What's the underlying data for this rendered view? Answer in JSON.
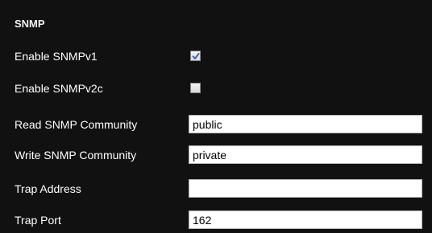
{
  "section": {
    "title": "SNMP"
  },
  "fields": {
    "snmpv1": {
      "label": "Enable SNMPv1",
      "checked": true
    },
    "snmpv2c": {
      "label": "Enable SNMPv2c",
      "checked": false
    },
    "read_community": {
      "label": "Read SNMP Community",
      "value": "public",
      "placeholder": ""
    },
    "write_community": {
      "label": "Write SNMP Community",
      "value": "private",
      "placeholder": ""
    },
    "trap_address": {
      "label": "Trap Address",
      "value": "",
      "placeholder": ""
    },
    "trap_port": {
      "label": "Trap Port",
      "value": "162",
      "placeholder": ""
    }
  },
  "icons": {
    "check": "checkmark-icon"
  },
  "colors": {
    "background": "#111111",
    "text": "#ffffff",
    "checkmark": "#3a55b4"
  }
}
